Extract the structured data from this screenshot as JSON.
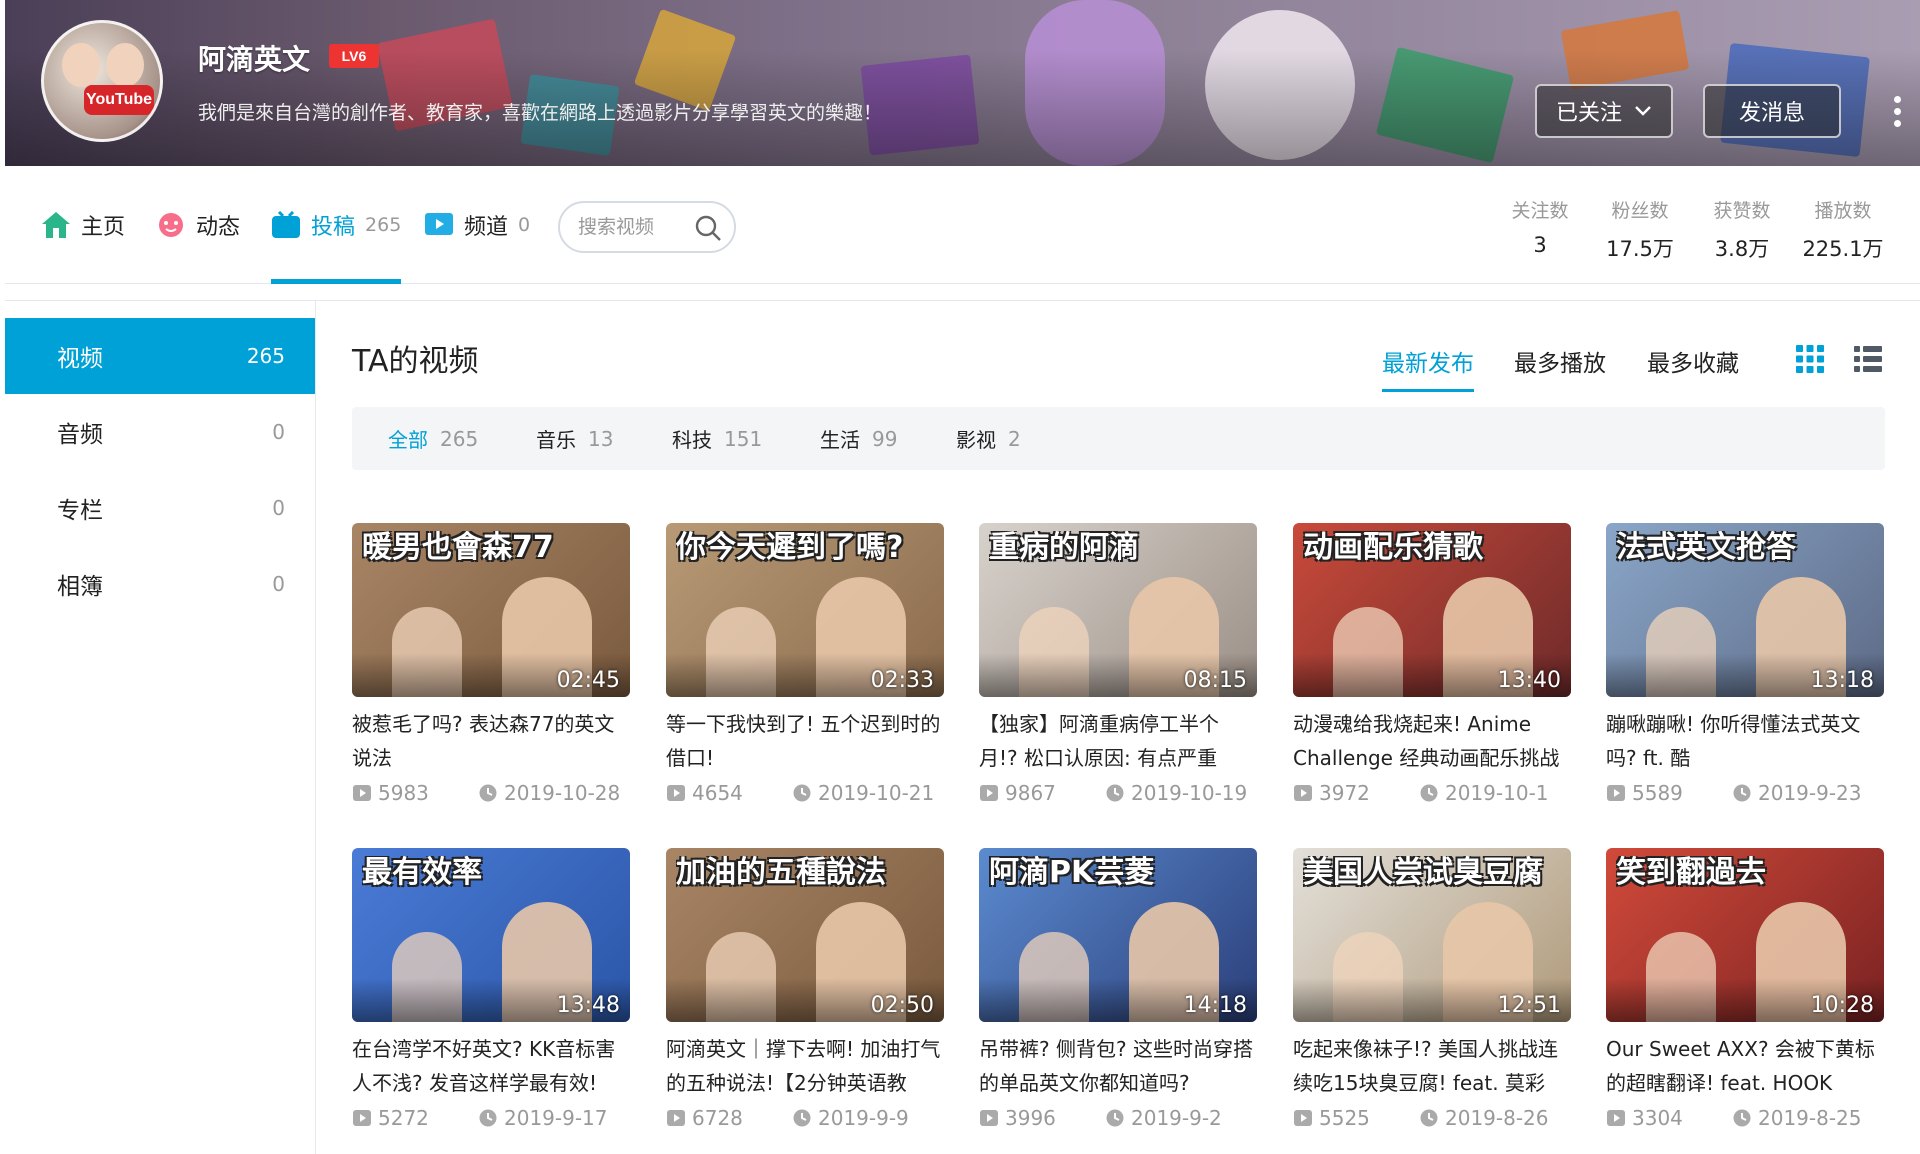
{
  "profile": {
    "name": "阿滴英文",
    "level": "LV6",
    "sign": "我們是來自台灣的創作者、教育家，喜歡在網路上透過影片分享學習英文的樂趣！",
    "avatar_label": "YouTube",
    "follow_label": "已关注",
    "message_label": "发消息"
  },
  "nav": {
    "home": "主页",
    "dynamic": "动态",
    "contribute": "投稿",
    "contribute_count": "265",
    "channel": "频道",
    "channel_count": "0",
    "search_placeholder": "搜索视频"
  },
  "stats": [
    {
      "label": "关注数",
      "value": "3"
    },
    {
      "label": "粉丝数",
      "value": "17.5万"
    },
    {
      "label": "获赞数",
      "value": "3.8万"
    },
    {
      "label": "播放数",
      "value": "225.1万"
    }
  ],
  "menu": [
    {
      "label": "视频",
      "count": "265"
    },
    {
      "label": "音频",
      "count": "0"
    },
    {
      "label": "专栏",
      "count": "0"
    },
    {
      "label": "相簿",
      "count": "0"
    }
  ],
  "section_title": "TA的视频",
  "sort": [
    "最新发布",
    "最多播放",
    "最多收藏"
  ],
  "tags": [
    {
      "label": "全部",
      "count": "265"
    },
    {
      "label": "音乐",
      "count": "13"
    },
    {
      "label": "科技",
      "count": "151"
    },
    {
      "label": "生活",
      "count": "99"
    },
    {
      "label": "影视",
      "count": "2"
    }
  ],
  "videos": [
    {
      "thumb_text": "暖男也會森77",
      "duration": "02:45",
      "title": "被惹毛了吗? 表达森77的英文说法",
      "plays": "5983",
      "date": "2019-10-28",
      "color1": "#a88565",
      "color2": "#7a5a3e"
    },
    {
      "thumb_text": "你今天遲到了嗎?",
      "duration": "02:33",
      "title": "等一下我快到了! 五个迟到时的借口!",
      "plays": "4654",
      "date": "2019-10-21",
      "color1": "#b89a76",
      "color2": "#8a6a4c"
    },
    {
      "thumb_text": "重病的阿滴",
      "duration": "08:15",
      "title": "【独家】阿滴重病停工半个月!? 松口认原因: 有点严重",
      "plays": "9867",
      "date": "2019-10-19",
      "color1": "#d8d2cc",
      "color2": "#9b8f86"
    },
    {
      "thumb_text": "动画配乐猜歌",
      "duration": "13:40",
      "title": "动漫魂给我烧起来! Anime Challenge 经典动画配乐挑战",
      "plays": "3972",
      "date": "2019-10-1",
      "color1": "#c94a3a",
      "color2": "#6e2a2a"
    },
    {
      "thumb_text": "法式英文抢答",
      "duration": "13:18",
      "title": "蹦啾蹦啾! 你听得懂法式英文吗? ft. 酷",
      "plays": "5589",
      "date": "2019-9-23",
      "color1": "#8aa6c8",
      "color2": "#5d6a86"
    },
    {
      "thumb_text": "最有效率",
      "duration": "13:48",
      "title": "在台湾学不好英文? KK音标害人不浅? 发音这样学最有效!",
      "plays": "5272",
      "date": "2019-9-17",
      "color1": "#4a7bd6",
      "color2": "#2b56a8"
    },
    {
      "thumb_text": "加油的五種說法",
      "duration": "02:50",
      "title": "阿滴英文｜撑下去啊! 加油打气的五种说法!【2分钟英语教",
      "plays": "6728",
      "date": "2019-9-9",
      "color1": "#a88565",
      "color2": "#7a5a3e"
    },
    {
      "thumb_text": "阿滴PK芸菱",
      "duration": "14:18",
      "title": "吊带裤? 侧背包? 这些时尚穿搭的单品英文你都知道吗?",
      "plays": "3996",
      "date": "2019-9-2",
      "color1": "#5b8bd0",
      "color2": "#2b3f7a"
    },
    {
      "thumb_text": "美国人尝试臭豆腐",
      "duration": "12:51",
      "title": "吃起来像袜子!? 美国人挑战连续吃15块臭豆腐! feat. 莫彩",
      "plays": "5525",
      "date": "2019-8-26",
      "color1": "#e3e0da",
      "color2": "#b09a7a"
    },
    {
      "thumb_text": "笑到翻過去",
      "duration": "10:28",
      "title": "Our Sweet AXX? 会被下黄标的超瞎翻译! feat. HOOK",
      "plays": "3304",
      "date": "2019-8-25",
      "color1": "#d14a3a",
      "color2": "#7a2222"
    }
  ]
}
